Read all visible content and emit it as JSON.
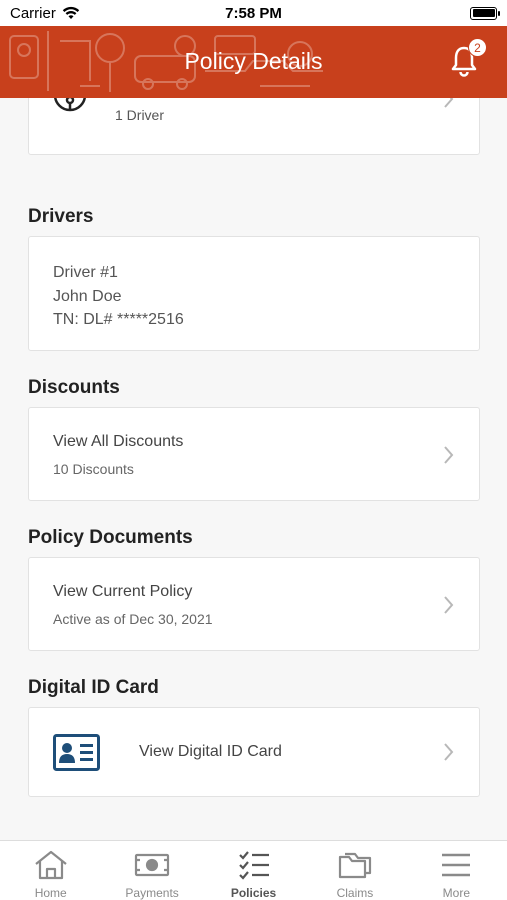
{
  "status_bar": {
    "carrier": "Carrier",
    "time": "7:58 PM"
  },
  "header": {
    "title": "Policy Details",
    "notification_count": "2",
    "accent": "#c8401c"
  },
  "vehicle": {
    "subtitle": "1 Driver"
  },
  "drivers": {
    "section_title": "Drivers",
    "lines": [
      "Driver #1",
      "John Doe",
      "TN: DL# *****2516"
    ]
  },
  "discounts": {
    "section_title": "Discounts",
    "label": "View All Discounts",
    "sub": "10 Discounts"
  },
  "documents": {
    "section_title": "Policy Documents",
    "label": "View Current Policy",
    "sub": "Active as of Dec 30, 2021"
  },
  "id_card": {
    "section_title": "Digital ID Card",
    "label": "View Digital ID Card",
    "icon_color": "#1e4e79"
  },
  "tabs": [
    {
      "label": "Home",
      "icon": "home-icon"
    },
    {
      "label": "Payments",
      "icon": "cash-icon"
    },
    {
      "label": "Policies",
      "icon": "checklist-icon",
      "active": true
    },
    {
      "label": "Claims",
      "icon": "folder-icon"
    },
    {
      "label": "More",
      "icon": "menu-icon"
    }
  ]
}
